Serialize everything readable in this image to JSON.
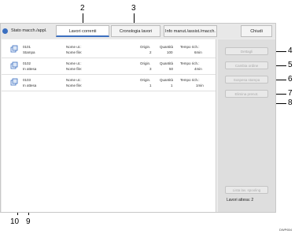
{
  "tabs": {
    "status": "Stato macch./appl.",
    "current_jobs": "Lavori correnti",
    "history": "Cronologia lavori",
    "info": "Info manut./assist./macch.",
    "close": "Chiudi"
  },
  "columns": {
    "user_name": "Nome ut.:",
    "file_name": "Nome file:",
    "originals": "Origin.",
    "quantity": "Quantità",
    "time": "Tempo rich.:"
  },
  "jobs": [
    {
      "id": "0101",
      "status": "Stampa",
      "originals": "2",
      "quantity": "100",
      "time": "6min"
    },
    {
      "id": "0102",
      "status": "In attesa",
      "originals": "3",
      "quantity": "50",
      "time": "4min"
    },
    {
      "id": "0103",
      "status": "In attesa",
      "originals": "1",
      "quantity": "1",
      "time": "1min"
    }
  ],
  "side_buttons": {
    "details": "Dettagli",
    "change_order": "Cambia ordine",
    "print_settings": "Sospesa stampa",
    "delete_reservation": "Elimina prenot.",
    "spooling": "Lista lav. spooling"
  },
  "waiting_jobs": "Lavori attesa:  2",
  "callouts": [
    "2",
    "3",
    "4",
    "5",
    "6",
    "7",
    "8",
    "10",
    "9"
  ],
  "figure_code": "DWP654",
  "colors": {
    "accent": "#3b6fc0",
    "panel": "#ececec"
  }
}
